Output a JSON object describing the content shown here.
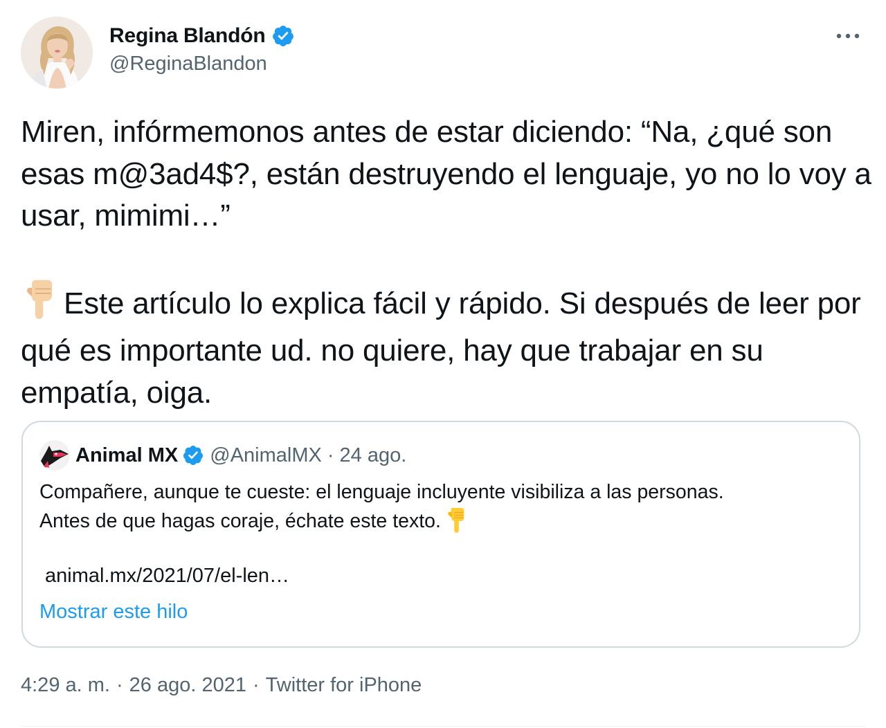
{
  "author": {
    "display_name": "Regina Blandón",
    "handle": "@ReginaBlandon",
    "verified": true
  },
  "tweet": {
    "paragraph_1": "Miren, infórmemonos antes de estar diciendo: “Na, ¿qué son esas m@3ad4$?, están destruyendo el lenguaje, yo no lo voy a usar, mimimi…”",
    "paragraph_2": "Este artículo lo explica fácil y rápido. Si después de leer por qué es importante ud. no quiere, hay que trabajar en su empatía, oiga."
  },
  "quoted_tweet": {
    "display_name": "Animal MX",
    "handle": "@AnimalMX",
    "separator": "·",
    "date": "24 ago.",
    "line_1": "Compañere, aunque te cueste: el lenguaje incluyente visibiliza a las personas.",
    "line_2": "Antes de que hagas coraje, échate este texto.",
    "link": "animal.mx/2021/07/el-len…",
    "show_thread": "Mostrar este hilo"
  },
  "meta": {
    "time": "4:29 a. m.",
    "separator": "·",
    "date": "26 ago. 2021",
    "source": "Twitter for iPhone"
  },
  "icons": {
    "verified": "verified-badge-icon",
    "more": "more-horizontal-icon",
    "emoji": "backhand-index-pointing-down-emoji"
  },
  "colors": {
    "accent": "#1d9bf0",
    "text": "#0f1419",
    "secondary": "#536471",
    "border": "#cfd9de"
  }
}
